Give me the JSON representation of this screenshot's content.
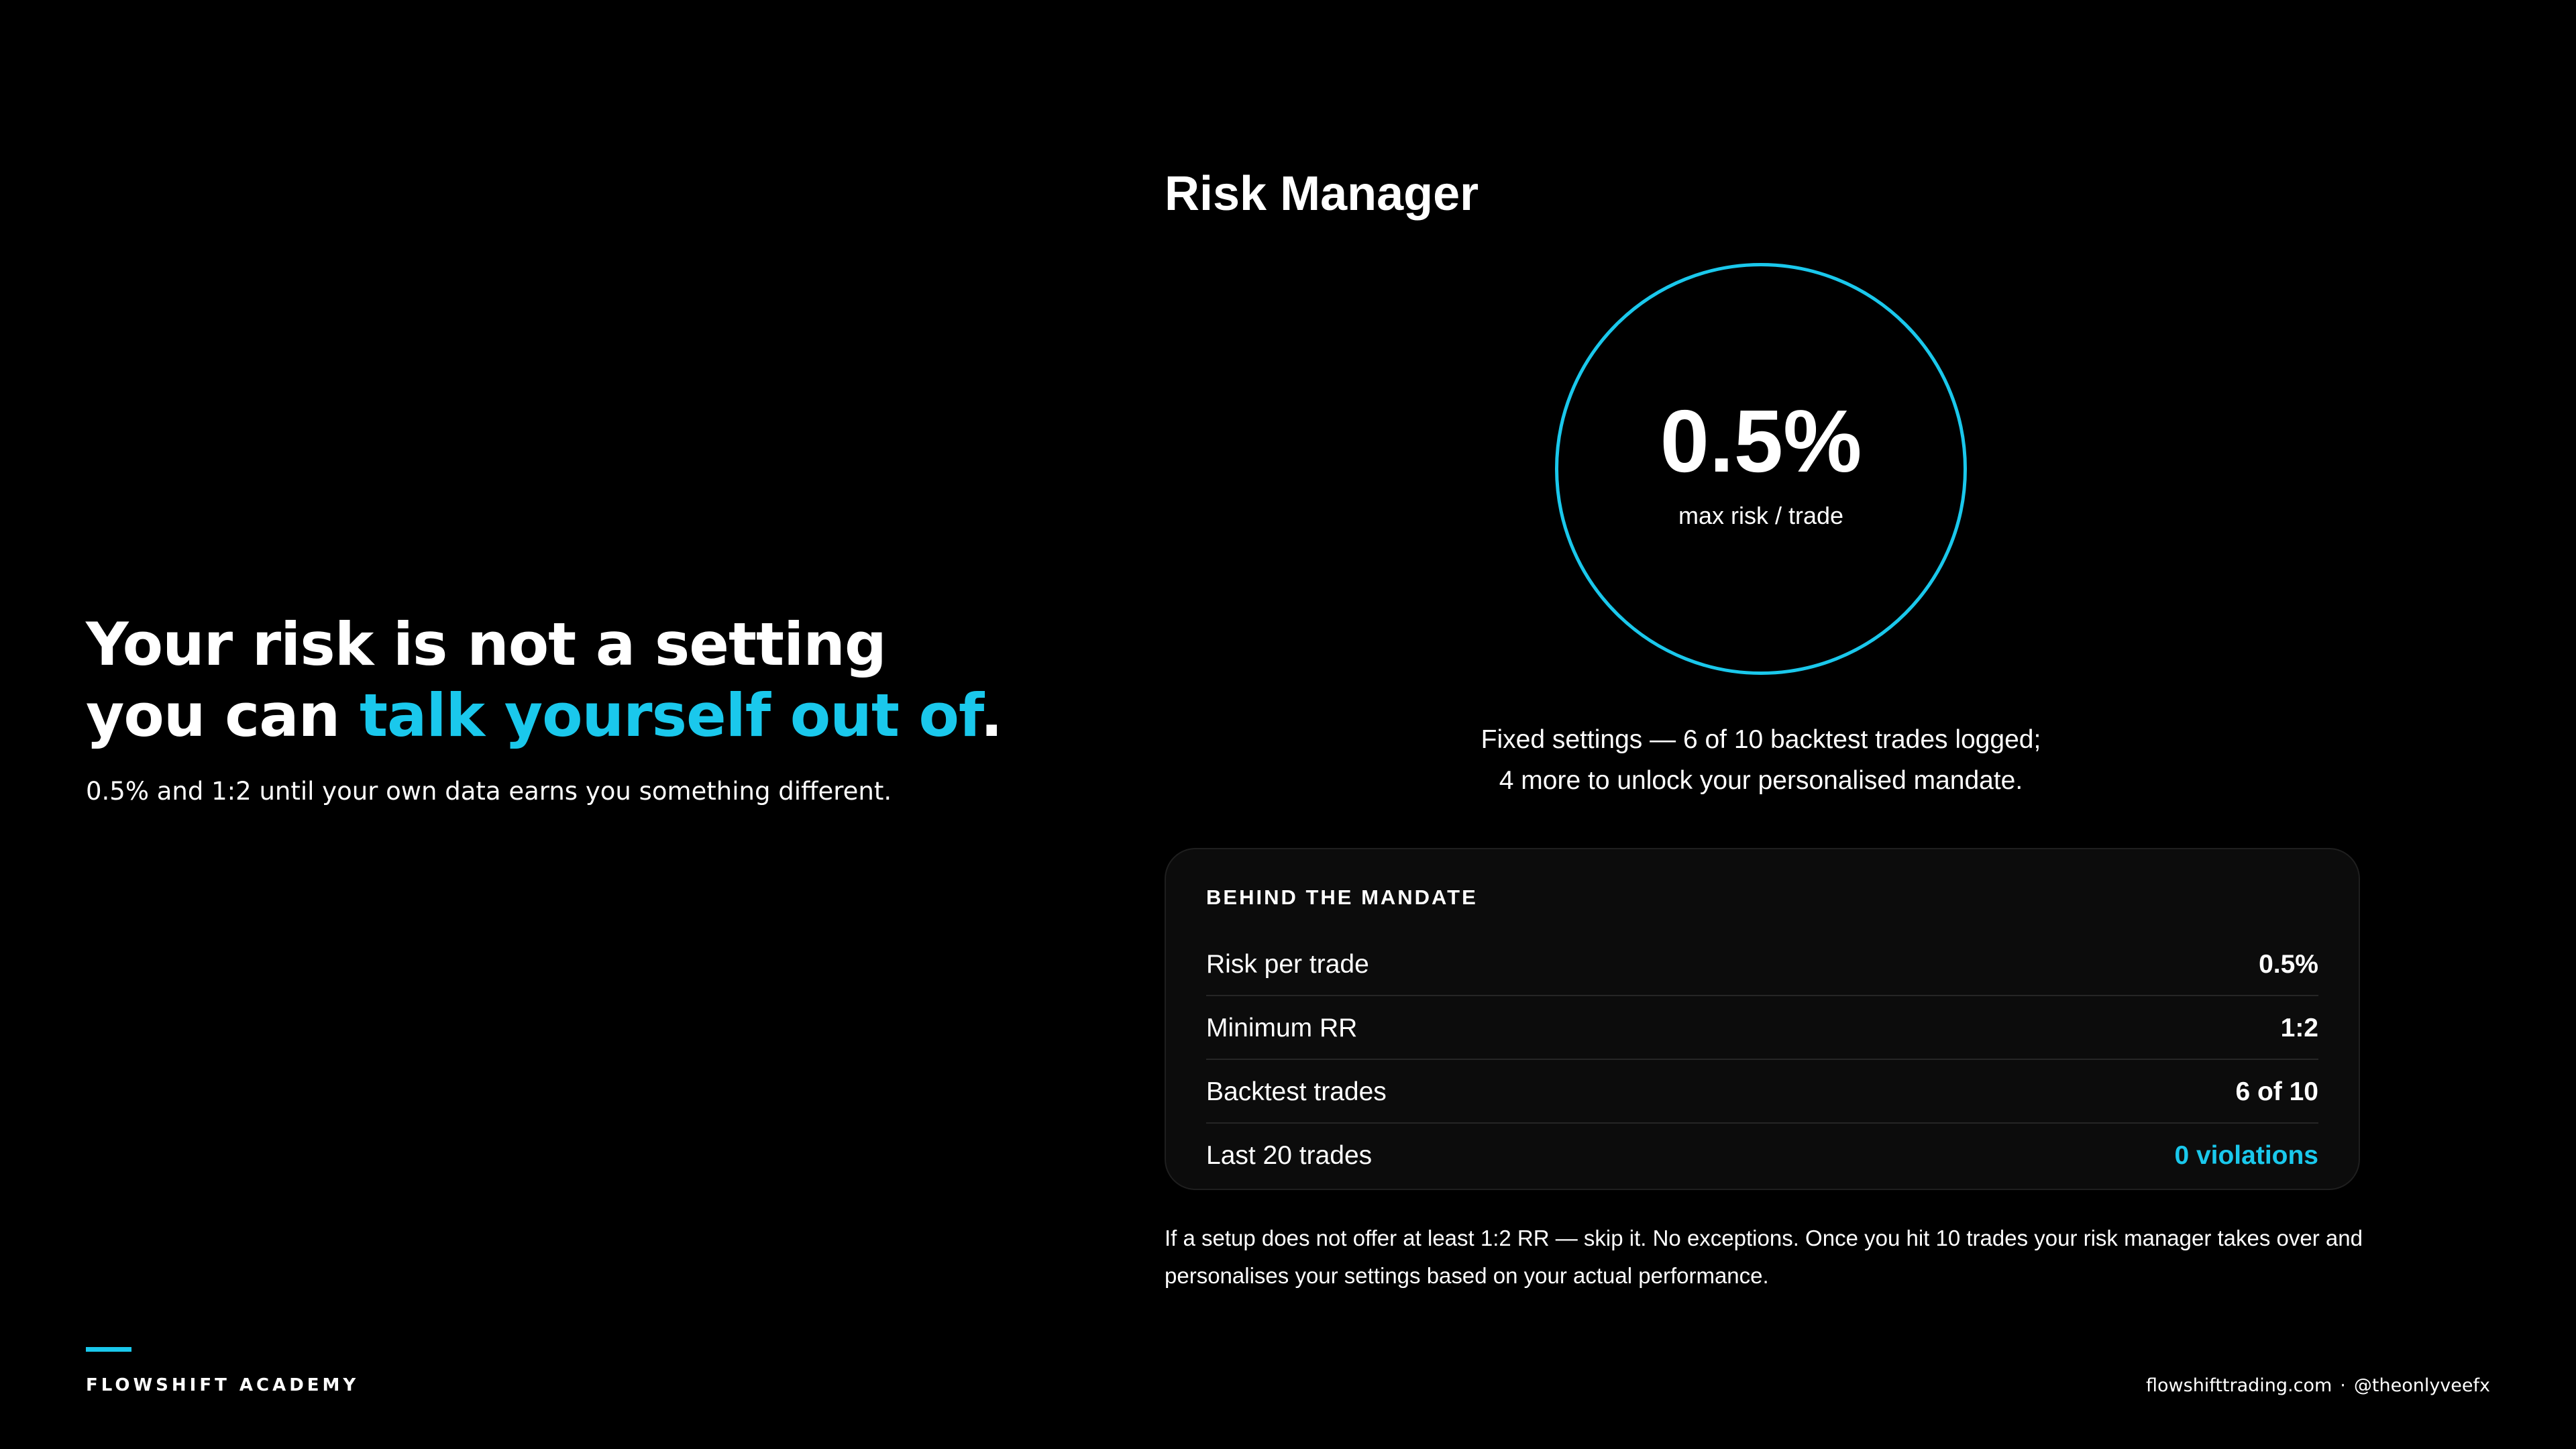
{
  "hero": {
    "headline_line1": "Your risk is not a setting",
    "headline_line2_prefix": "you can ",
    "headline_line2_accent": "talk yourself out of",
    "headline_line2_suffix": ".",
    "subline": "0.5% and 1:2 until your own data earns you something different."
  },
  "risk_manager": {
    "title": "Risk Manager",
    "gauge": {
      "value": "0.5%",
      "label": "max risk / trade"
    },
    "status_note": "Fixed settings — 6 of 10 backtest trades logged; 4 more to unlock your personalised mandate.",
    "mandate": {
      "heading": "BEHIND THE MANDATE",
      "rows": [
        {
          "label": "Risk per trade",
          "value": "0.5%"
        },
        {
          "label": "Minimum RR",
          "value": "1:2"
        },
        {
          "label": "Backtest trades",
          "value": "6 of 10"
        },
        {
          "label": "Last 20 trades",
          "value": "0 violations"
        }
      ]
    },
    "rule_note": "If a setup does not offer at least 1:2 RR — skip it. No exceptions. Once you hit 10 trades your risk manager takes over and personalises your settings based on your actual performance."
  },
  "footer": {
    "brand": "FLOWSHIFT ACADEMY",
    "website": "flowshifttrading.com",
    "separator": "·",
    "handle": "@theonlyveefx"
  },
  "colors": {
    "background": "#000000",
    "accent": "#1ac8ec",
    "text": "#ffffff",
    "card_background": "#0c0c0c",
    "card_border": "#1f1f1f"
  }
}
